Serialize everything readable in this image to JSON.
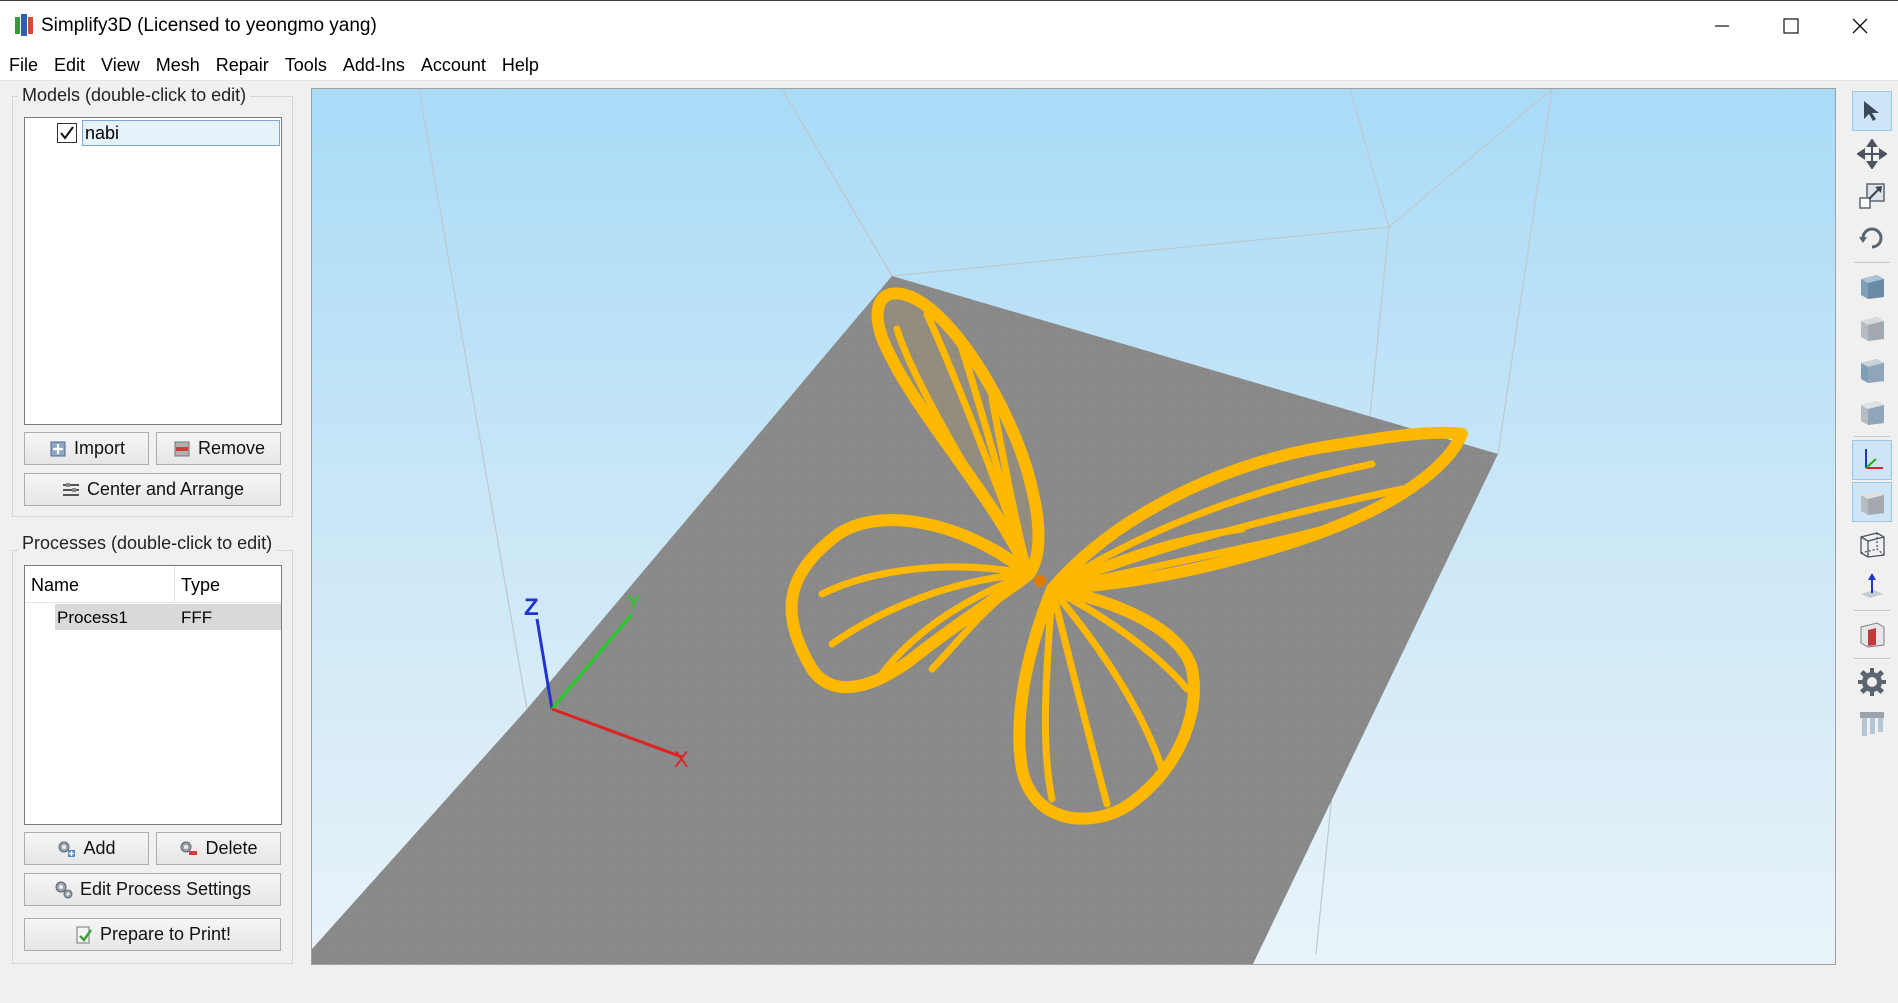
{
  "window": {
    "title": "Simplify3D (Licensed to yeongmo yang)",
    "controls": [
      "minimize",
      "maximize",
      "close"
    ]
  },
  "menu": [
    "File",
    "Edit",
    "View",
    "Mesh",
    "Repair",
    "Tools",
    "Add-Ins",
    "Account",
    "Help"
  ],
  "models": {
    "header": "Models (double-click to edit)",
    "items": [
      {
        "name": "nabi",
        "checked": true
      }
    ],
    "import_label": "Import",
    "remove_label": "Remove",
    "center_label": "Center and Arrange"
  },
  "processes": {
    "header": "Processes (double-click to edit)",
    "columns": [
      "Name",
      "Type"
    ],
    "rows": [
      {
        "name": "Process1",
        "type": "FFF"
      }
    ],
    "add_label": "Add",
    "delete_label": "Delete",
    "edit_label": "Edit Process Settings",
    "prepare_label": "Prepare to Print!"
  },
  "viewport": {
    "axis_x": "X",
    "axis_y": "Y",
    "axis_z": "Z",
    "model_color": "#ffb800",
    "bed_color": "#8a8a8a"
  },
  "toolbar": [
    "select-icon",
    "move-icon",
    "scale-icon",
    "rotate-icon",
    "view-default-icon",
    "view-front-icon",
    "view-left-icon",
    "view-right-icon",
    "axes-icon",
    "solid-icon",
    "wireframe-icon",
    "normals-icon",
    "cross-section-icon",
    "settings-icon",
    "supports-icon"
  ]
}
